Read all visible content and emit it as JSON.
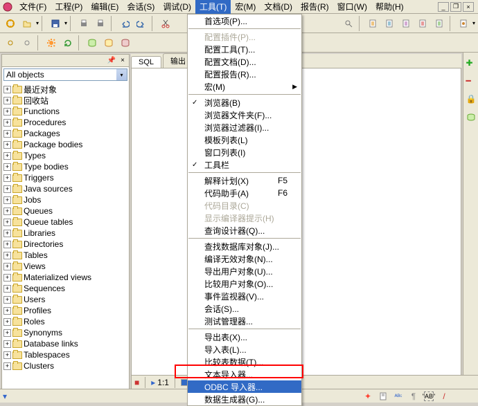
{
  "menu": {
    "items": [
      "文件(F)",
      "工程(P)",
      "编辑(E)",
      "会话(S)",
      "调试(D)",
      "工具(T)",
      "宏(M)",
      "文档(D)",
      "报告(R)",
      "窗口(W)",
      "帮助(H)"
    ],
    "activeIndex": 5
  },
  "sidebar": {
    "combo": "All objects",
    "tree": [
      "最近对象",
      "回收站",
      "Functions",
      "Procedures",
      "Packages",
      "Package bodies",
      "Types",
      "Type bodies",
      "Triggers",
      "Java sources",
      "Jobs",
      "Queues",
      "Queue tables",
      "Libraries",
      "Directories",
      "Tables",
      "Views",
      "Materialized views",
      "Sequences",
      "Users",
      "Profiles",
      "Roles",
      "Synonyms",
      "Database links",
      "Tablespaces",
      "Clusters"
    ]
  },
  "tabs": {
    "sql": "SQL",
    "output": "输出"
  },
  "dropdown": [
    {
      "t": "item",
      "label": "首选项(P)..."
    },
    {
      "t": "sep"
    },
    {
      "t": "item",
      "label": "配置插件(P)...",
      "disabled": true
    },
    {
      "t": "item",
      "label": "配置工具(T)..."
    },
    {
      "t": "item",
      "label": "配置文档(D)..."
    },
    {
      "t": "item",
      "label": "配置报告(R)..."
    },
    {
      "t": "item",
      "label": "宏(M)",
      "arrow": true
    },
    {
      "t": "sep"
    },
    {
      "t": "item",
      "label": "浏览器(B)",
      "check": true
    },
    {
      "t": "item",
      "label": "浏览器文件夹(F)..."
    },
    {
      "t": "item",
      "label": "浏览器过滤器(I)..."
    },
    {
      "t": "item",
      "label": "模板列表(L)"
    },
    {
      "t": "item",
      "label": "窗口列表(I)"
    },
    {
      "t": "item",
      "label": "工具栏",
      "check": true
    },
    {
      "t": "sep"
    },
    {
      "t": "item",
      "label": "解释计划(X)",
      "shortcut": "F5"
    },
    {
      "t": "item",
      "label": "代码助手(A)",
      "shortcut": "F6"
    },
    {
      "t": "item",
      "label": "代码目录(C)",
      "disabled": true
    },
    {
      "t": "item",
      "label": "显示编译器提示(H)",
      "disabled": true
    },
    {
      "t": "item",
      "label": "查询设计器(Q)..."
    },
    {
      "t": "sep"
    },
    {
      "t": "item",
      "label": "查找数据库对象(J)..."
    },
    {
      "t": "item",
      "label": "编译无效对象(N)..."
    },
    {
      "t": "item",
      "label": "导出用户对象(U)..."
    },
    {
      "t": "item",
      "label": "比较用户对象(O)..."
    },
    {
      "t": "item",
      "label": "事件监视器(V)..."
    },
    {
      "t": "item",
      "label": "会话(S)..."
    },
    {
      "t": "item",
      "label": "测试管理器..."
    },
    {
      "t": "sep"
    },
    {
      "t": "item",
      "label": "导出表(X)..."
    },
    {
      "t": "item",
      "label": "导入表(L)..."
    },
    {
      "t": "item",
      "label": "比较表数据(T)..."
    },
    {
      "t": "item",
      "label": "文本导入器..."
    },
    {
      "t": "item",
      "label": "ODBC 导入器...",
      "highlight": true
    },
    {
      "t": "item",
      "label": "数据生成器(G)..."
    }
  ],
  "status": {
    "pos": "1:1",
    "ab": "\"AB\""
  }
}
